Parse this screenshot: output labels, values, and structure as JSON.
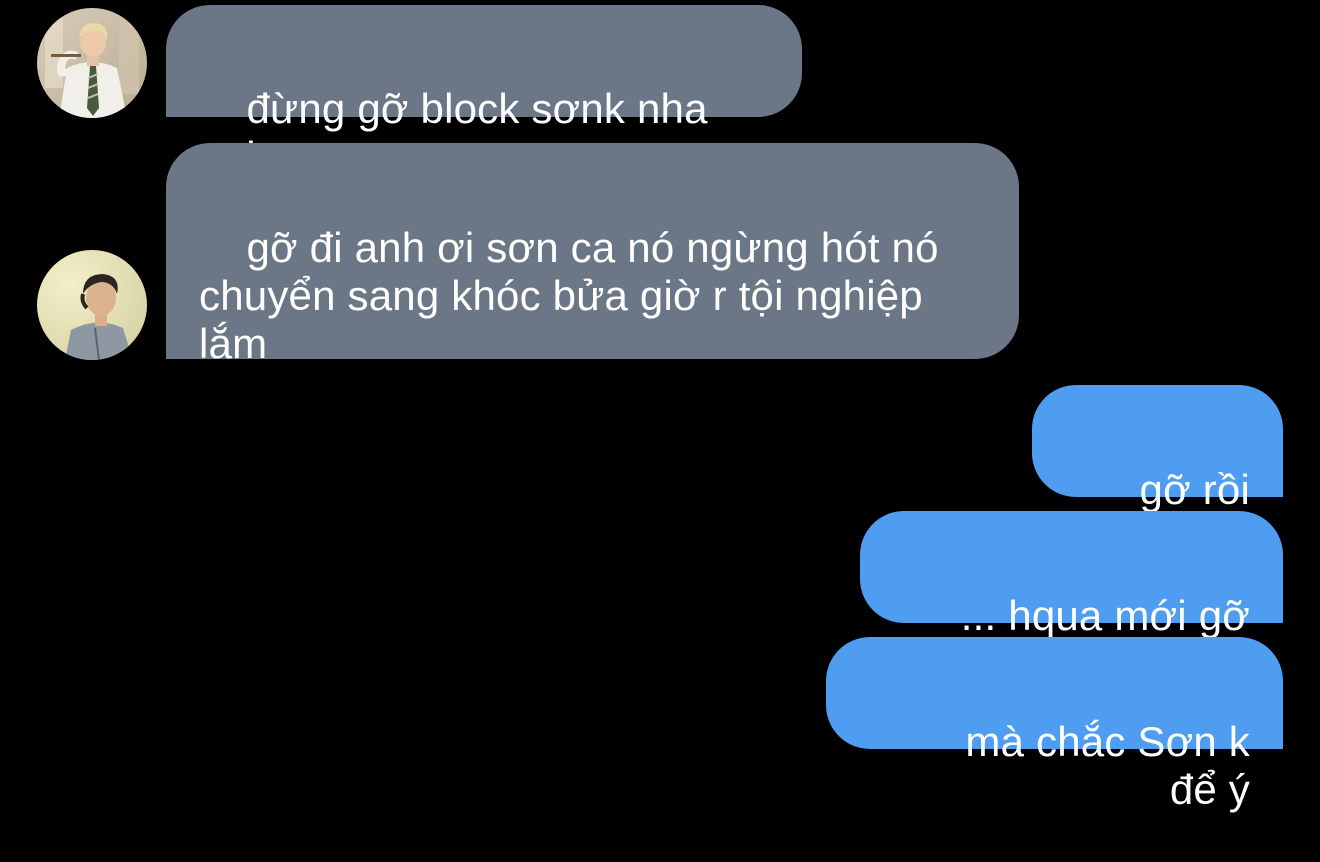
{
  "conversation": {
    "messages": [
      {
        "sender": "other",
        "text": "đừng gỡ block sơnk nha anh"
      },
      {
        "sender": "other",
        "text": "gỡ đi anh ơi sơn ca nó ngừng hót nó\nchuyển sang khóc bửa giờ r tội nghiệp\nlắm"
      },
      {
        "sender": "me",
        "text": "gỡ rồi mà"
      },
      {
        "sender": "me",
        "text": "... hqua mới gỡ rồi"
      },
      {
        "sender": "me",
        "text": "mà chắc Sơn k để ý"
      }
    ]
  },
  "colors": {
    "background": "#000000",
    "incoming_bubble": "#6b7686",
    "outgoing_bubble": "#4e9df0",
    "text": "#ffffff"
  },
  "icons": {
    "avatar_1": "avatar-photo-man-in-white-shirt-and-tie",
    "avatar_2": "avatar-photo-man-in-grey-jacket"
  }
}
